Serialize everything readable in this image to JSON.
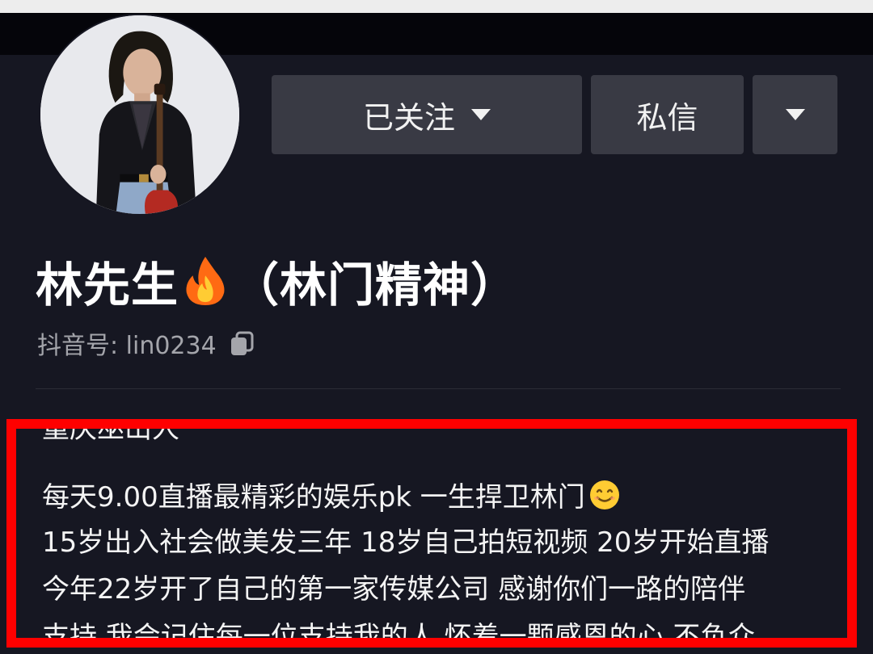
{
  "profile": {
    "display_name": "林先生",
    "name_suffix": "（林门精神）",
    "douyin_id_label": "抖音号: lin0234",
    "name_emoji_icon": "fire-icon"
  },
  "actions": {
    "follow_label": "已关注",
    "message_label": "私信",
    "follow_dropdown_icon": "triangle-down-icon",
    "more_icon": "triangle-down-icon"
  },
  "bio": {
    "lines": [
      "重庆巫山人",
      "每天9.00直播最精彩的娱乐pk  一生捍卫林门",
      "15岁出入社会做美发三年 18岁自己拍短视频 20岁开始直播",
      "今年22岁开了自己的第一家传媒公司  感谢你们一路的陪伴",
      "支持 我会记住每一位支持我的人 怀着一颗感恩的心 不负众"
    ],
    "line1_emoji_icon": "smile-icon"
  },
  "colors": {
    "background": "#161722",
    "button": "#393a44",
    "highlight_border": "#ff0000",
    "secondary_text": "#a4a5ab"
  }
}
